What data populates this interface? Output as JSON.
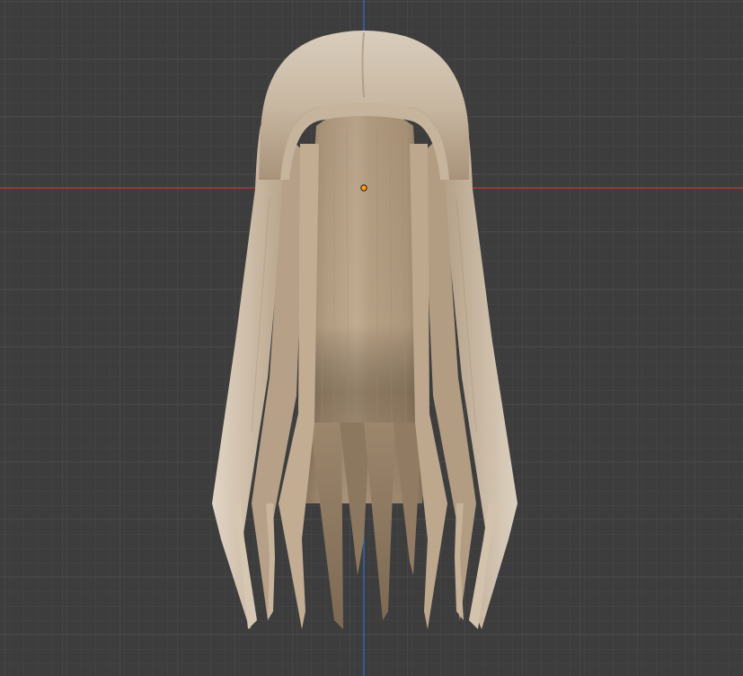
{
  "viewport": {
    "background_color": "#3d3d3d",
    "grid_minor_color": "#474747",
    "grid_major_color": "#525252",
    "x_axis_color": "#c2383c",
    "y_axis_color": "#2f6fd3"
  },
  "scene": {
    "object": "hair-mesh",
    "shading": "solid",
    "hair_base_color": "#b9a58c",
    "hair_highlight_color": "#d9cbb8",
    "hair_shadow_color": "#6f5d48",
    "origin_color": "#f7a21b"
  }
}
